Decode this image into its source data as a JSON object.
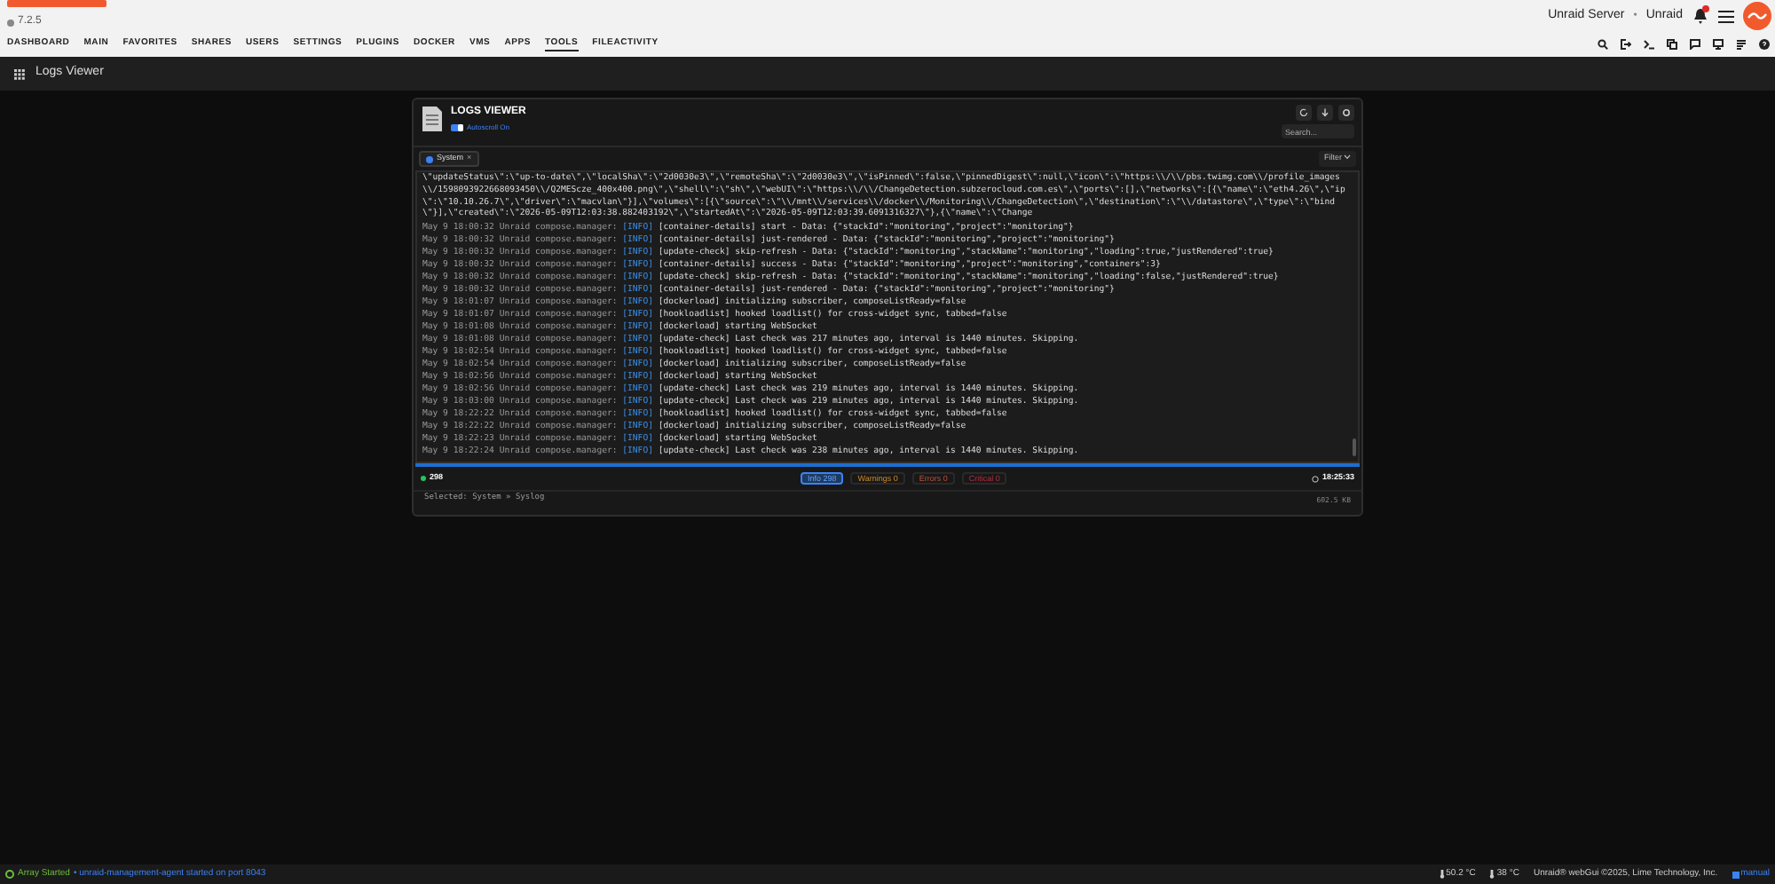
{
  "brand": {
    "version": "7.2.5"
  },
  "server": {
    "name": "Unraid Server",
    "separator": "•",
    "tag": "Unraid",
    "has_notification": true
  },
  "nav": [
    {
      "label": "DASHBOARD",
      "selected": false
    },
    {
      "label": "MAIN",
      "selected": false
    },
    {
      "label": "FAVORITES",
      "selected": false
    },
    {
      "label": "SHARES",
      "selected": false
    },
    {
      "label": "USERS",
      "selected": false
    },
    {
      "label": "SETTINGS",
      "selected": false
    },
    {
      "label": "PLUGINS",
      "selected": false
    },
    {
      "label": "DOCKER",
      "selected": false
    },
    {
      "label": "VMS",
      "selected": false
    },
    {
      "label": "APPS",
      "selected": false
    },
    {
      "label": "TOOLS",
      "selected": true
    },
    {
      "label": "FILEACTIVITY",
      "selected": false
    }
  ],
  "page_title": "Logs Viewer",
  "viewer": {
    "title": "LOGS VIEWER",
    "autoscroll": {
      "label": "Autoscroll On",
      "on": true
    },
    "search": {
      "placeholder": "Search..."
    },
    "source_chip": {
      "label": "System",
      "close": "×",
      "color": "#3b82f6"
    },
    "filter": "Filter",
    "prelude": "\\\"updateStatus\\\":\\\"up-to-date\\\",\\\"localSha\\\":\\\"2d0030e3\\\",\\\"remoteSha\\\":\\\"2d0030e3\\\",\\\"isPinned\\\":false,\\\"pinnedDigest\\\":null,\\\"icon\\\":\\\"https:\\\\/\\\\/pbs.twimg.com\\\\/profile_images\\\\/1598093922668093450\\\\/Q2MEScze_400x400.png\\\",\\\"shell\\\":\\\"sh\\\",\\\"webUI\\\":\\\"https:\\\\/\\\\/ChangeDetection.subzerocloud.com.es\\\",\\\"ports\\\":[],\\\"networks\\\":[{\\\"name\\\":\\\"eth4.26\\\",\\\"ip\\\":\\\"10.10.26.7\\\",\\\"driver\\\":\\\"macvlan\\\"}],\\\"volumes\\\":[{\\\"source\\\":\\\"\\\\/mnt\\\\/services\\\\/docker\\\\/Monitoring\\\\/ChangeDetection\\\",\\\"destination\\\":\\\"\\\\/datastore\\\",\\\"type\\\":\\\"bind\\\"}],\\\"created\\\":\\\"2026-05-09T12:03:38.882403192\\\",\\\"startedAt\\\":\\\"2026-05-09T12:03:39.6091316327\\\"},{\\\"name\\\":\\\"Change",
    "entries": [
      {
        "time": "May 9 18:00:32",
        "source": "Unraid compose.manager:",
        "level": "[INFO]",
        "message": "[container-details] start  - Data: {\"stackId\":\"monitoring\",\"project\":\"monitoring\"}"
      },
      {
        "time": "May 9 18:00:32",
        "source": "Unraid compose.manager:",
        "level": "[INFO]",
        "message": "[container-details] just-rendered  - Data: {\"stackId\":\"monitoring\",\"project\":\"monitoring\"}"
      },
      {
        "time": "May 9 18:00:32",
        "source": "Unraid compose.manager:",
        "level": "[INFO]",
        "message": "[update-check] skip-refresh  - Data: {\"stackId\":\"monitoring\",\"stackName\":\"monitoring\",\"loading\":true,\"justRendered\":true}"
      },
      {
        "time": "May 9 18:00:32",
        "source": "Unraid compose.manager:",
        "level": "[INFO]",
        "message": "[container-details] success  - Data: {\"stackId\":\"monitoring\",\"project\":\"monitoring\",\"containers\":3}"
      },
      {
        "time": "May 9 18:00:32",
        "source": "Unraid compose.manager:",
        "level": "[INFO]",
        "message": "[update-check] skip-refresh  - Data: {\"stackId\":\"monitoring\",\"stackName\":\"monitoring\",\"loading\":false,\"justRendered\":true}"
      },
      {
        "time": "May 9 18:00:32",
        "source": "Unraid compose.manager:",
        "level": "[INFO]",
        "message": "[container-details] just-rendered  - Data: {\"stackId\":\"monitoring\",\"project\":\"monitoring\"}"
      },
      {
        "time": "May 9 18:01:07",
        "source": "Unraid compose.manager:",
        "level": "[INFO]",
        "message": "[dockerload] initializing subscriber, composeListReady=false"
      },
      {
        "time": "May 9 18:01:07",
        "source": "Unraid compose.manager:",
        "level": "[INFO]",
        "message": "[hookloadlist] hooked loadlist() for cross-widget sync, tabbed=false"
      },
      {
        "time": "May 9 18:01:08",
        "source": "Unraid compose.manager:",
        "level": "[INFO]",
        "message": "[dockerload] starting WebSocket"
      },
      {
        "time": "May 9 18:01:08",
        "source": "Unraid compose.manager:",
        "level": "[INFO]",
        "message": "[update-check] Last check was 217 minutes ago, interval is 1440 minutes. Skipping."
      },
      {
        "time": "May 9 18:02:54",
        "source": "Unraid compose.manager:",
        "level": "[INFO]",
        "message": "[hookloadlist] hooked loadlist() for cross-widget sync, tabbed=false"
      },
      {
        "time": "May 9 18:02:54",
        "source": "Unraid compose.manager:",
        "level": "[INFO]",
        "message": "[dockerload] initializing subscriber, composeListReady=false"
      },
      {
        "time": "May 9 18:02:56",
        "source": "Unraid compose.manager:",
        "level": "[INFO]",
        "message": "[dockerload] starting WebSocket"
      },
      {
        "time": "May 9 18:02:56",
        "source": "Unraid compose.manager:",
        "level": "[INFO]",
        "message": "[update-check] Last check was 219 minutes ago, interval is 1440 minutes. Skipping."
      },
      {
        "time": "May 9 18:03:00",
        "source": "Unraid compose.manager:",
        "level": "[INFO]",
        "message": "[update-check] Last check was 219 minutes ago, interval is 1440 minutes. Skipping."
      },
      {
        "time": "May 9 18:22:22",
        "source": "Unraid compose.manager:",
        "level": "[INFO]",
        "message": "[hookloadlist] hooked loadlist() for cross-widget sync, tabbed=false"
      },
      {
        "time": "May 9 18:22:22",
        "source": "Unraid compose.manager:",
        "level": "[INFO]",
        "message": "[dockerload] initializing subscriber, composeListReady=false"
      },
      {
        "time": "May 9 18:22:23",
        "source": "Unraid compose.manager:",
        "level": "[INFO]",
        "message": "[dockerload] starting WebSocket"
      },
      {
        "time": "May 9 18:22:24",
        "source": "Unraid compose.manager:",
        "level": "[INFO]",
        "message": "[update-check] Last check was 238 minutes ago, interval is 1440 minutes. Skipping."
      }
    ],
    "total": "298",
    "counts": [
      {
        "kind": "info",
        "label": "Info",
        "count": "298",
        "selected": true
      },
      {
        "kind": "warning",
        "label": "Warnings",
        "count": "0",
        "selected": false
      },
      {
        "kind": "error",
        "label": "Errors",
        "count": "0",
        "selected": false
      },
      {
        "kind": "critical",
        "label": "Critical",
        "count": "0",
        "selected": false
      }
    ],
    "clock": "18:25:33",
    "selected_text": "Selected: System » Syslog",
    "size": "602.5 KB"
  },
  "status_bar": {
    "array": "Array Started",
    "message": "• unraid-management-agent started on port 8043",
    "cpu_temp": "50.2 °C",
    "disk_temp": "38 °C",
    "copyright": "Unraid® webGui ©2025, Lime Technology, Inc.",
    "manual": "manual"
  }
}
